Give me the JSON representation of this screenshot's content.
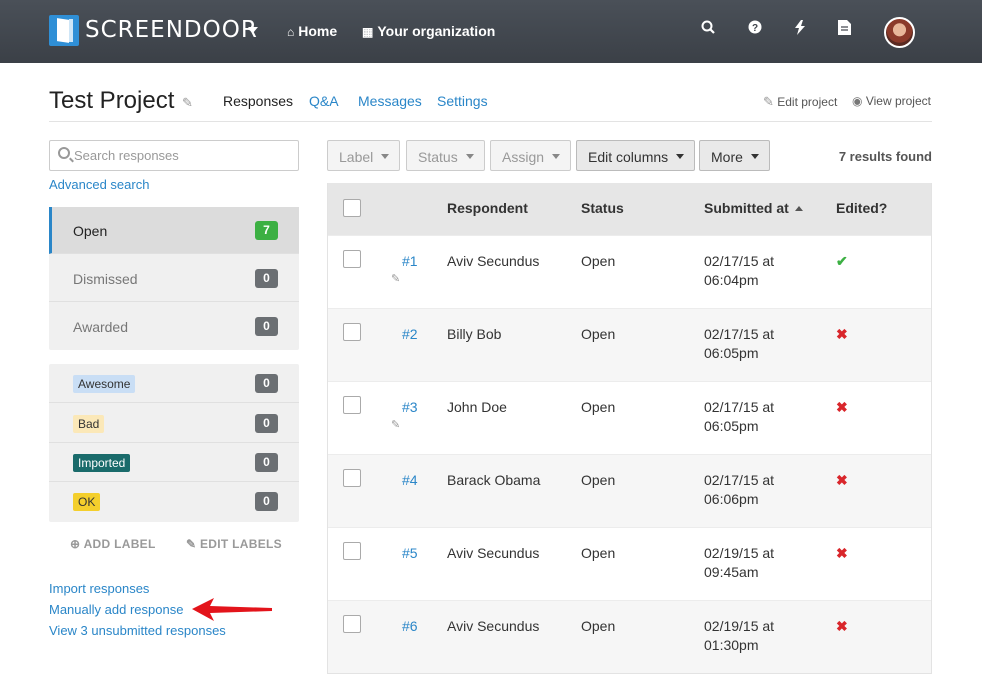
{
  "app": {
    "brand": "SCREENDOOR",
    "nav": [
      {
        "label": "Home"
      },
      {
        "label": "Your organization"
      }
    ],
    "icons": [
      "search-icon",
      "help-icon",
      "bolt-icon",
      "document-icon"
    ]
  },
  "project": {
    "title": "Test Project",
    "tabs": [
      "Responses",
      "Q&A",
      "Messages",
      "Settings"
    ],
    "edit_project": "Edit project",
    "view_project": "View project"
  },
  "sidebar": {
    "search_placeholder": "Search responses",
    "advanced_search": "Advanced search",
    "statuses": [
      {
        "label": "Open",
        "count": "7"
      },
      {
        "label": "Dismissed",
        "count": "0"
      },
      {
        "label": "Awarded",
        "count": "0"
      }
    ],
    "labels": [
      {
        "label": "Awesome",
        "count": "0",
        "color": "#c9def5",
        "text_color": "#333"
      },
      {
        "label": "Bad",
        "count": "0",
        "color": "#fbe8b8",
        "text_color": "#333"
      },
      {
        "label": "Imported",
        "count": "0",
        "color": "#1a6b6b",
        "text_color": "#ffffff"
      },
      {
        "label": "OK",
        "count": "0",
        "color": "#f4cf2c",
        "text_color": "#333"
      }
    ],
    "add_label": "ADD LABEL",
    "edit_labels": "EDIT LABELS",
    "links": [
      "Import responses",
      "Manually add response",
      "View 3 unsubmitted responses"
    ]
  },
  "toolbar": {
    "buttons": [
      "Label",
      "Status",
      "Assign",
      "Edit columns",
      "More"
    ],
    "results": "7 results found"
  },
  "table": {
    "headers": [
      "Respondent",
      "Status",
      "Submitted at",
      "Edited?"
    ],
    "rows": [
      {
        "id": "#1",
        "respondent": "Aviv Secundus",
        "status": "Open",
        "date": "02/17/15 at",
        "time": "06:04pm",
        "edited": true,
        "pencil": true
      },
      {
        "id": "#2",
        "respondent": "Billy Bob",
        "status": "Open",
        "date": "02/17/15 at",
        "time": "06:05pm",
        "edited": false,
        "pencil": false
      },
      {
        "id": "#3",
        "respondent": "John Doe",
        "status": "Open",
        "date": "02/17/15 at",
        "time": "06:05pm",
        "edited": false,
        "pencil": true
      },
      {
        "id": "#4",
        "respondent": "Barack Obama",
        "status": "Open",
        "date": "02/17/15 at",
        "time": "06:06pm",
        "edited": false,
        "pencil": false
      },
      {
        "id": "#5",
        "respondent": "Aviv Secundus",
        "status": "Open",
        "date": "02/19/15 at",
        "time": "09:45am",
        "edited": false,
        "pencil": false
      },
      {
        "id": "#6",
        "respondent": "Aviv Secundus",
        "status": "Open",
        "date": "02/19/15 at",
        "time": "01:30pm",
        "edited": false,
        "pencil": false
      }
    ]
  },
  "colors": {
    "link": "#2a86c8",
    "topbar": "#3f444b",
    "success": "#3cb043",
    "danger": "#d9262b",
    "annotation_arrow": "#e3141b"
  }
}
